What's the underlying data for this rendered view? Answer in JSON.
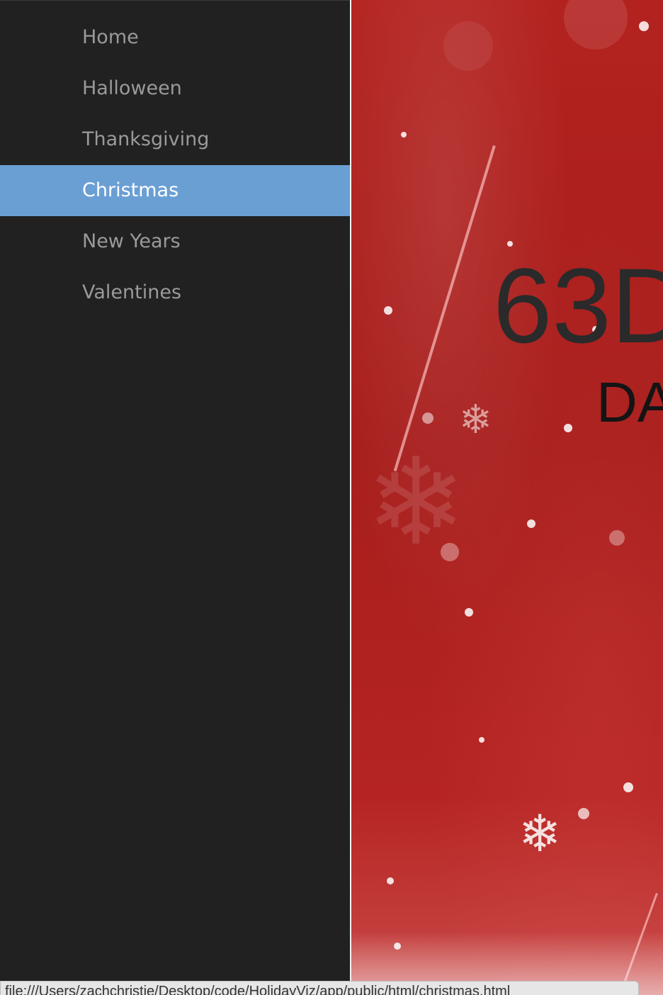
{
  "sidebar": {
    "items": [
      {
        "label": "Home",
        "active": false
      },
      {
        "label": "Halloween",
        "active": false
      },
      {
        "label": "Thanksgiving",
        "active": false
      },
      {
        "label": "Christmas",
        "active": true
      },
      {
        "label": "New Years",
        "active": false
      },
      {
        "label": "Valentines",
        "active": false
      }
    ]
  },
  "main": {
    "countdown_number": "63D",
    "countdown_unit": "DA"
  },
  "status_bar": {
    "url": "file:///Users/zachchristie/Desktop/code/HolidayViz/app/public/html/christmas.html"
  },
  "colors": {
    "sidebar_bg": "#212121",
    "active_item_bg": "#6a9fd4",
    "hero_red": "#b3221f"
  }
}
